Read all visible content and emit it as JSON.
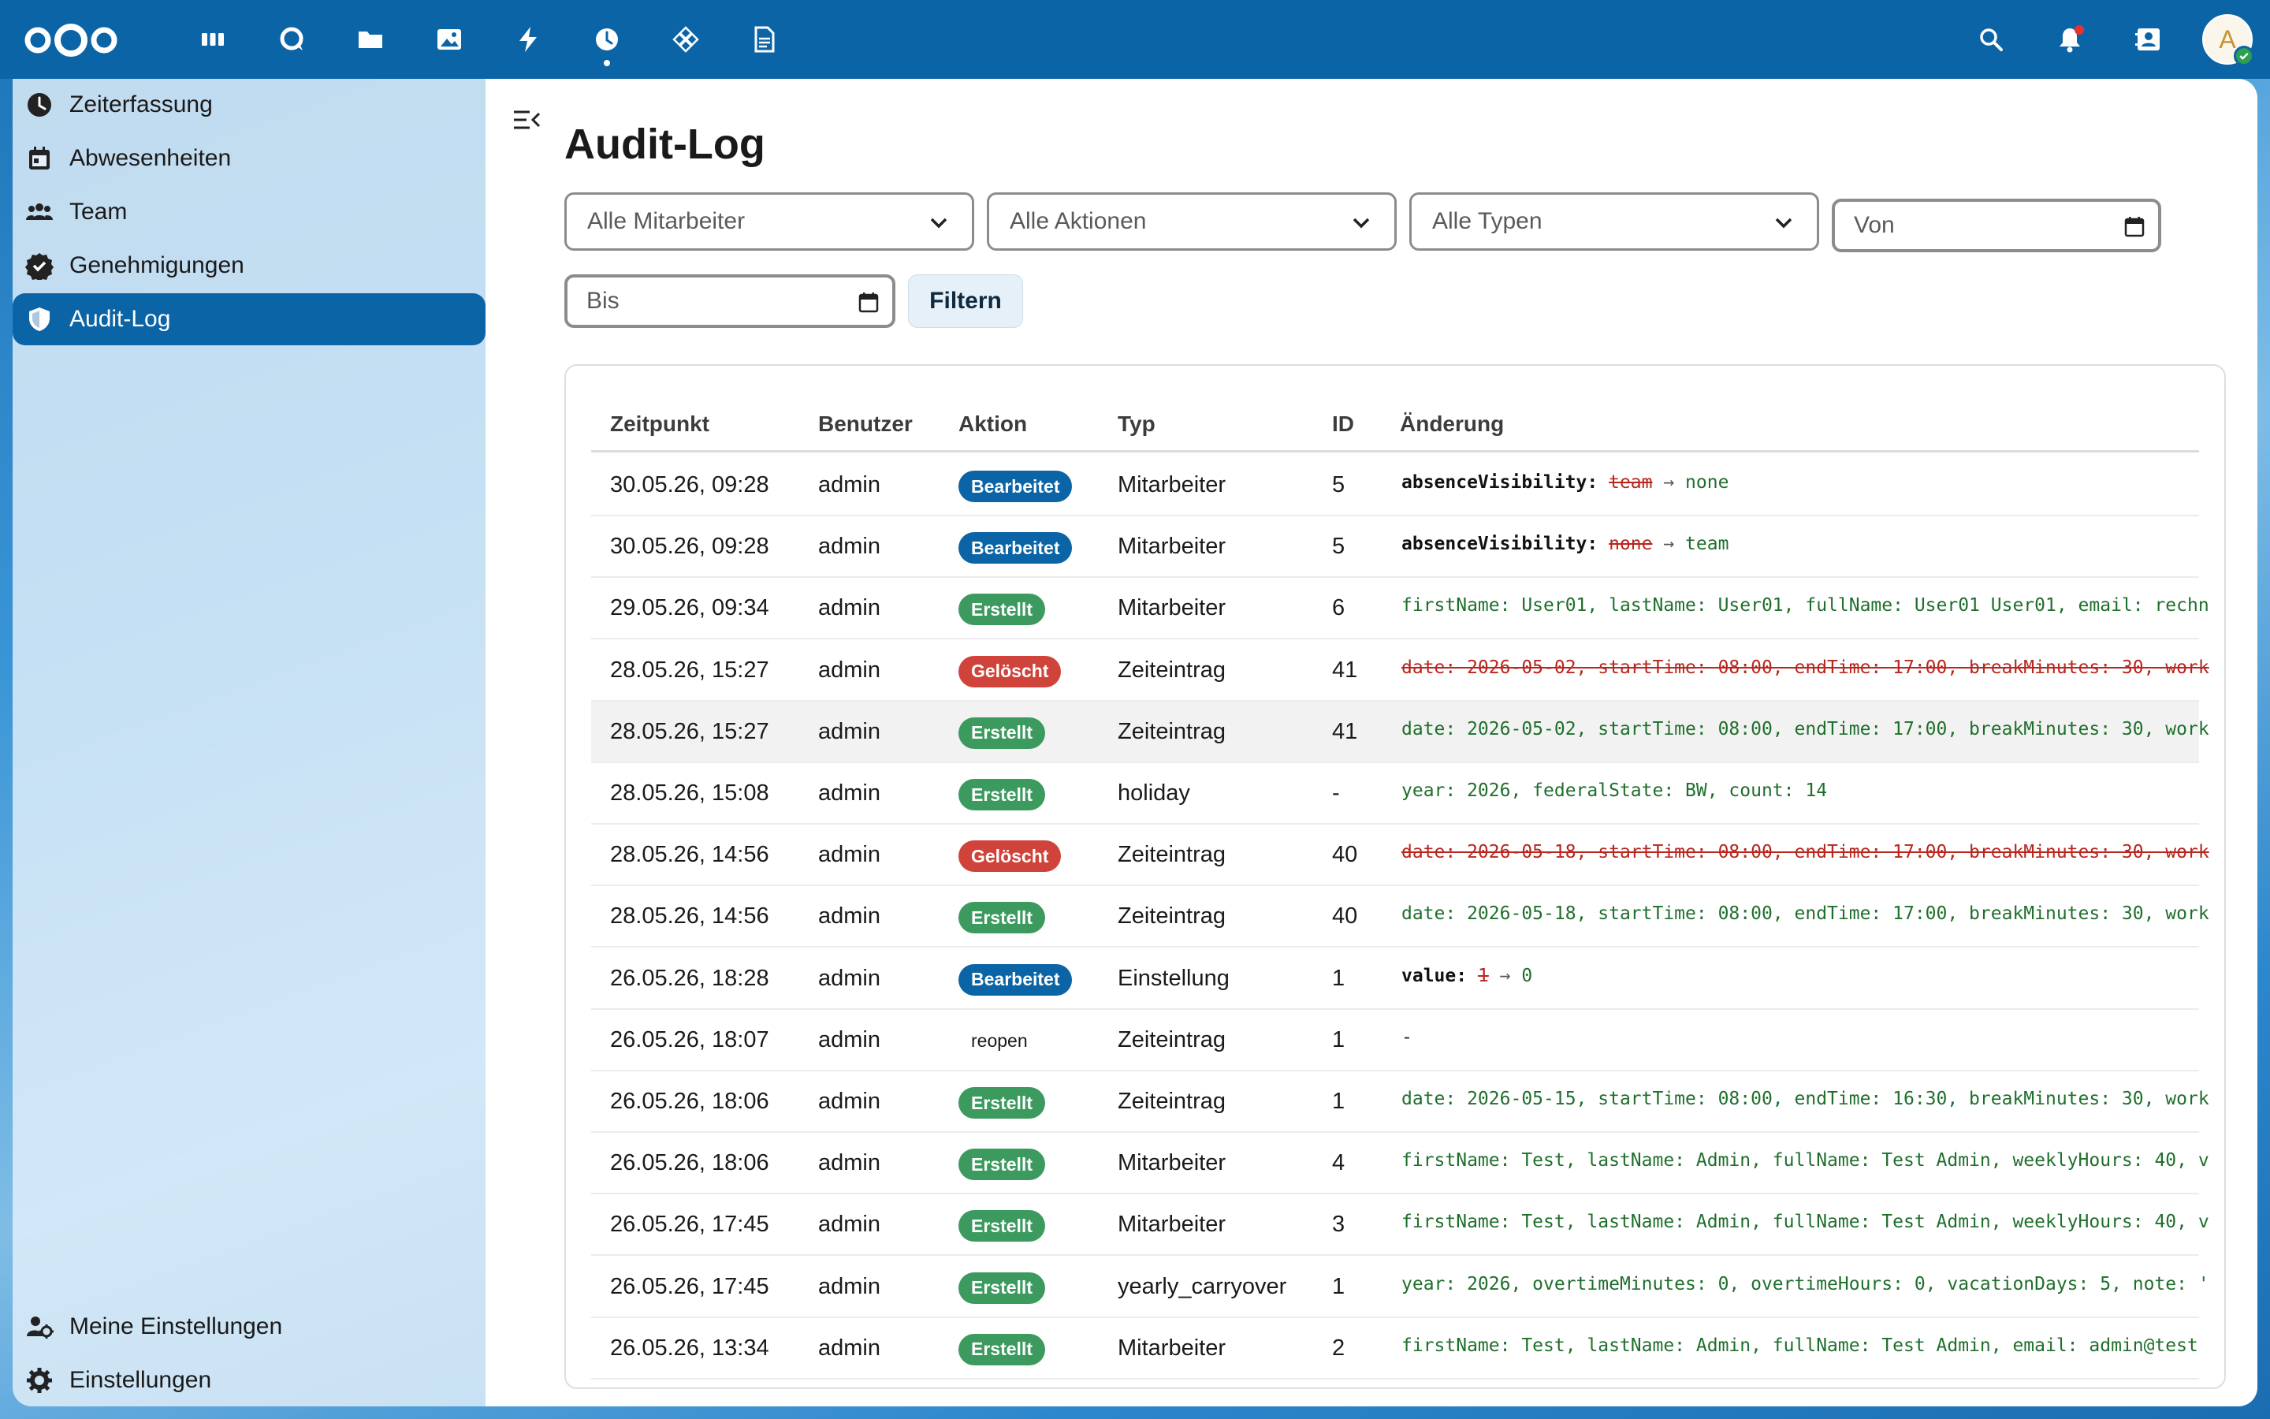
{
  "header": {
    "avatar_initial": "A",
    "apps": [
      "dashboard-icon",
      "talk-icon",
      "files-icon",
      "photos-icon",
      "activity-icon",
      "timetracking-icon",
      "deck-icon",
      "notes-icon"
    ],
    "active_app": "timetracking-icon"
  },
  "sidebar": {
    "items": [
      {
        "label": "Zeiterfassung",
        "icon": "clock-icon"
      },
      {
        "label": "Abwesenheiten",
        "icon": "calendar-icon"
      },
      {
        "label": "Team",
        "icon": "team-icon"
      },
      {
        "label": "Genehmigungen",
        "icon": "approval-icon"
      },
      {
        "label": "Audit-Log",
        "icon": "shield-icon"
      }
    ],
    "footer": [
      {
        "label": "Meine Einstellungen",
        "icon": "user-settings-icon"
      },
      {
        "label": "Einstellungen",
        "icon": "gear-icon"
      }
    ]
  },
  "page": {
    "title": "Audit-Log",
    "filters": {
      "employee": "Alle Mitarbeiter",
      "action": "Alle Aktionen",
      "type": "Alle Typen",
      "from_placeholder": "Von",
      "to_placeholder": "Bis",
      "filter_button": "Filtern"
    }
  },
  "table": {
    "columns": [
      "Zeitpunkt",
      "Benutzer",
      "Aktion",
      "Typ",
      "ID",
      "Änderung"
    ],
    "rows": [
      {
        "time": "30.05.26, 09:28",
        "user": "admin",
        "action": "Bearbeitet",
        "kind": "edit",
        "type": "Mitarbeiter",
        "id": "5",
        "change_key": "absenceVisibility:",
        "change_old": "team",
        "change_new": "none"
      },
      {
        "time": "30.05.26, 09:28",
        "user": "admin",
        "action": "Bearbeitet",
        "kind": "edit",
        "type": "Mitarbeiter",
        "id": "5",
        "change_key": "absenceVisibility:",
        "change_old": "none",
        "change_new": "team"
      },
      {
        "time": "29.05.26, 09:34",
        "user": "admin",
        "action": "Erstellt",
        "kind": "create",
        "type": "Mitarbeiter",
        "id": "6",
        "change_text": "firstName: User01, lastName: User01, fullName: User01 User01, email: rechn"
      },
      {
        "time": "28.05.26, 15:27",
        "user": "admin",
        "action": "Gelöscht",
        "kind": "delete",
        "type": "Zeiteintrag",
        "id": "41",
        "change_text": "date: 2026-05-02, startTime: 08:00, endTime: 17:00, breakMinutes: 30, work"
      },
      {
        "time": "28.05.26, 15:27",
        "user": "admin",
        "action": "Erstellt",
        "kind": "create",
        "type": "Zeiteintrag",
        "id": "41",
        "change_text": "date: 2026-05-02, startTime: 08:00, endTime: 17:00, breakMinutes: 30, work"
      },
      {
        "time": "28.05.26, 15:08",
        "user": "admin",
        "action": "Erstellt",
        "kind": "create",
        "type": "holiday",
        "id": "-",
        "change_text": "year: 2026, federalState: BW, count: 14"
      },
      {
        "time": "28.05.26, 14:56",
        "user": "admin",
        "action": "Gelöscht",
        "kind": "delete",
        "type": "Zeiteintrag",
        "id": "40",
        "change_text": "date: 2026-05-18, startTime: 08:00, endTime: 17:00, breakMinutes: 30, work"
      },
      {
        "time": "28.05.26, 14:56",
        "user": "admin",
        "action": "Erstellt",
        "kind": "create",
        "type": "Zeiteintrag",
        "id": "40",
        "change_text": "date: 2026-05-18, startTime: 08:00, endTime: 17:00, breakMinutes: 30, work"
      },
      {
        "time": "26.05.26, 18:28",
        "user": "admin",
        "action": "Bearbeitet",
        "kind": "edit",
        "type": "Einstellung",
        "id": "1",
        "change_key": "value:",
        "change_old": "1",
        "change_new": "0"
      },
      {
        "time": "26.05.26, 18:07",
        "user": "admin",
        "action": "reopen",
        "kind": "plain",
        "type": "Zeiteintrag",
        "id": "1",
        "change_text": "-"
      },
      {
        "time": "26.05.26, 18:06",
        "user": "admin",
        "action": "Erstellt",
        "kind": "create",
        "type": "Zeiteintrag",
        "id": "1",
        "change_text": "date: 2026-05-15, startTime: 08:00, endTime: 16:30, breakMinutes: 30, work"
      },
      {
        "time": "26.05.26, 18:06",
        "user": "admin",
        "action": "Erstellt",
        "kind": "create",
        "type": "Mitarbeiter",
        "id": "4",
        "change_text": "firstName: Test, lastName: Admin, fullName: Test Admin, weeklyHours: 40, v"
      },
      {
        "time": "26.05.26, 17:45",
        "user": "admin",
        "action": "Erstellt",
        "kind": "create",
        "type": "Mitarbeiter",
        "id": "3",
        "change_text": "firstName: Test, lastName: Admin, fullName: Test Admin, weeklyHours: 40, v"
      },
      {
        "time": "26.05.26, 17:45",
        "user": "admin",
        "action": "Erstellt",
        "kind": "create",
        "type": "yearly_carryover",
        "id": "1",
        "change_text": "year: 2026, overtimeMinutes: 0, overtimeHours: 0, vacationDays: 5, note: '"
      },
      {
        "time": "26.05.26, 13:34",
        "user": "admin",
        "action": "Erstellt",
        "kind": "create",
        "type": "Mitarbeiter",
        "id": "2",
        "change_text": "firstName: Test, lastName: Admin, fullName: Test Admin, email: admin@test"
      }
    ]
  },
  "colors": {
    "header_bg": "#0b64a6",
    "badge_edit": "#0b64a6",
    "badge_create": "#3c9a5f",
    "badge_delete": "#d0433b"
  }
}
